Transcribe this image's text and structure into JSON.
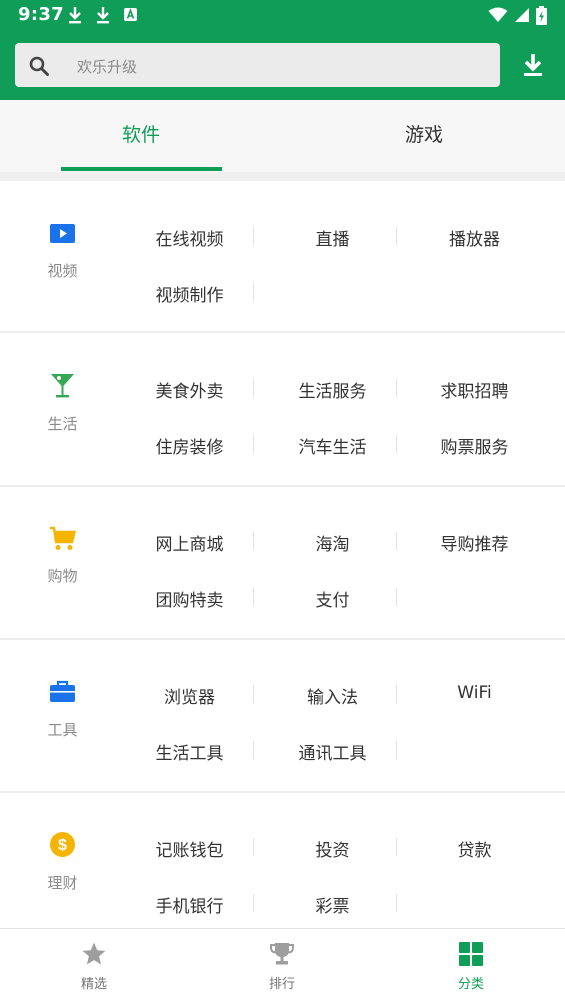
{
  "status_bar": {
    "time": "9:37"
  },
  "search": {
    "placeholder": "欢乐升级"
  },
  "tabs": [
    {
      "label": "软件",
      "active": true
    },
    {
      "label": "游戏",
      "active": false
    }
  ],
  "categories": [
    {
      "name": "视频",
      "icon": "video-play-icon",
      "items": [
        "在线视频",
        "直播",
        "播放器",
        "视频制作"
      ]
    },
    {
      "name": "生活",
      "icon": "cocktail-icon",
      "items": [
        "美食外卖",
        "生活服务",
        "求职招聘",
        "住房装修",
        "汽车生活",
        "购票服务"
      ]
    },
    {
      "name": "购物",
      "icon": "cart-icon",
      "items": [
        "网上商城",
        "海淘",
        "导购推荐",
        "团购特卖",
        "支付"
      ]
    },
    {
      "name": "工具",
      "icon": "toolbox-icon",
      "items": [
        "浏览器",
        "输入法",
        "WiFi",
        "生活工具",
        "通讯工具"
      ]
    },
    {
      "name": "理财",
      "icon": "dollar-coin-icon",
      "items": [
        "记账钱包",
        "投资",
        "贷款",
        "手机银行",
        "彩票"
      ]
    }
  ],
  "bottom_nav": [
    {
      "label": "精选",
      "icon": "star-icon",
      "active": false
    },
    {
      "label": "排行",
      "icon": "trophy-icon",
      "active": false
    },
    {
      "label": "分类",
      "icon": "grid-icon",
      "active": true
    }
  ],
  "colors": {
    "primary": "#0f9d58",
    "video": "#1a73e8",
    "life": "#34a853",
    "shopping": "#f4b400",
    "tools": "#1a73e8",
    "finance": "#f4b400",
    "inactive": "#9e9e9e"
  }
}
